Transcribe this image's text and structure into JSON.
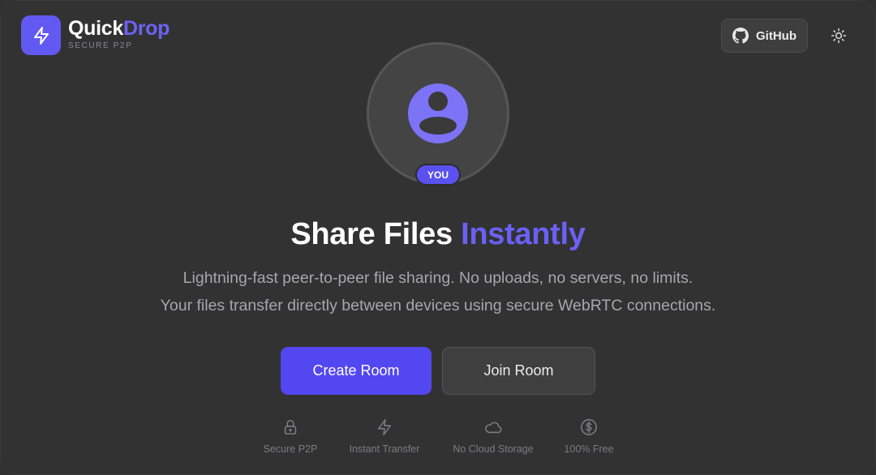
{
  "brand": {
    "name_main": "Quick",
    "name_accent": "Drop",
    "tagline": "SECURE P2P",
    "logo_icon": "lightning-icon"
  },
  "header": {
    "github_label": "GitHub",
    "github_icon": "github-icon",
    "theme_icon": "sun-icon"
  },
  "avatar": {
    "badge": "YOU",
    "icon": "user-icon"
  },
  "hero": {
    "title_main": "Share Files",
    "title_accent": "Instantly",
    "line1": "Lightning-fast peer-to-peer file sharing. No uploads, no servers, no limits.",
    "line2": "Your files transfer directly between devices using secure WebRTC connections."
  },
  "actions": {
    "create_label": "Create Room",
    "join_label": "Join Room"
  },
  "features": [
    {
      "label": "Secure P2P",
      "icon": "lock-icon"
    },
    {
      "label": "Instant Transfer",
      "icon": "lightning-icon"
    },
    {
      "label": "No Cloud Storage",
      "icon": "cloud-icon"
    },
    {
      "label": "100% Free",
      "icon": "dollar-icon"
    }
  ],
  "colors": {
    "background": "#323232",
    "accent": "#6259f3",
    "primary_button": "#5347f2",
    "muted_text": "#a7a7ac"
  }
}
